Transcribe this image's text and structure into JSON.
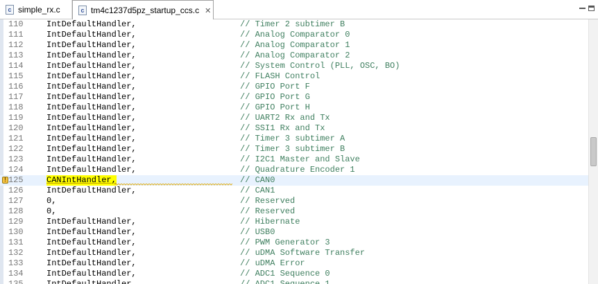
{
  "tabs": [
    {
      "label": "simple_rx.c",
      "icon": "c-file-icon",
      "active": false,
      "icon_glyph": "c"
    },
    {
      "label": "tm4c1237d5pz_startup_ccs.c",
      "icon": "c-file-icon",
      "active": true,
      "icon_glyph": "c",
      "close_glyph": "✕"
    }
  ],
  "editor": {
    "current_line": "125",
    "lines": [
      {
        "num": "110",
        "code": "IntDefaultHandler,",
        "comment": "// Timer 2 subtimer B"
      },
      {
        "num": "111",
        "code": "IntDefaultHandler,",
        "comment": "// Analog Comparator 0"
      },
      {
        "num": "112",
        "code": "IntDefaultHandler,",
        "comment": "// Analog Comparator 1"
      },
      {
        "num": "113",
        "code": "IntDefaultHandler,",
        "comment": "// Analog Comparator 2"
      },
      {
        "num": "114",
        "code": "IntDefaultHandler,",
        "comment": "// System Control (PLL, OSC, BO)"
      },
      {
        "num": "115",
        "code": "IntDefaultHandler,",
        "comment": "// FLASH Control"
      },
      {
        "num": "116",
        "code": "IntDefaultHandler,",
        "comment": "// GPIO Port F"
      },
      {
        "num": "117",
        "code": "IntDefaultHandler,",
        "comment": "// GPIO Port G"
      },
      {
        "num": "118",
        "code": "IntDefaultHandler,",
        "comment": "// GPIO Port H"
      },
      {
        "num": "119",
        "code": "IntDefaultHandler,",
        "comment": "// UART2 Rx and Tx"
      },
      {
        "num": "120",
        "code": "IntDefaultHandler,",
        "comment": "// SSI1 Rx and Tx"
      },
      {
        "num": "121",
        "code": "IntDefaultHandler,",
        "comment": "// Timer 3 subtimer A"
      },
      {
        "num": "122",
        "code": "IntDefaultHandler,",
        "comment": "// Timer 3 subtimer B"
      },
      {
        "num": "123",
        "code": "IntDefaultHandler,",
        "comment": "// I2C1 Master and Slave"
      },
      {
        "num": "124",
        "code": "IntDefaultHandler,",
        "comment": "// Quadrature Encoder 1"
      },
      {
        "num": "125",
        "code": "CANIntHandler,",
        "comment": "// CAN0"
      },
      {
        "num": "126",
        "code": "IntDefaultHandler,",
        "comment": "// CAN1"
      },
      {
        "num": "127",
        "code": "0,",
        "comment": "// Reserved"
      },
      {
        "num": "128",
        "code": "0,",
        "comment": "// Reserved"
      },
      {
        "num": "129",
        "code": "IntDefaultHandler,",
        "comment": "// Hibernate"
      },
      {
        "num": "130",
        "code": "IntDefaultHandler,",
        "comment": "// USB0"
      },
      {
        "num": "131",
        "code": "IntDefaultHandler,",
        "comment": "// PWM Generator 3"
      },
      {
        "num": "132",
        "code": "IntDefaultHandler,",
        "comment": "// uDMA Software Transfer"
      },
      {
        "num": "133",
        "code": "IntDefaultHandler,",
        "comment": "// uDMA Error"
      },
      {
        "num": "134",
        "code": "IntDefaultHandler,",
        "comment": "// ADC1 Sequence 0"
      },
      {
        "num": "135",
        "code": "IntDefaultHandler,",
        "comment": "// ADC1 Sequence 1"
      }
    ],
    "warning_line": "125",
    "warning_icon": "warning-icon",
    "warning_glyph": "!",
    "colors": {
      "comment": "#3f7f5f",
      "highlight": "#ffff00",
      "current_line_bg": "#e8f2fe",
      "line_number": "#787878"
    }
  }
}
